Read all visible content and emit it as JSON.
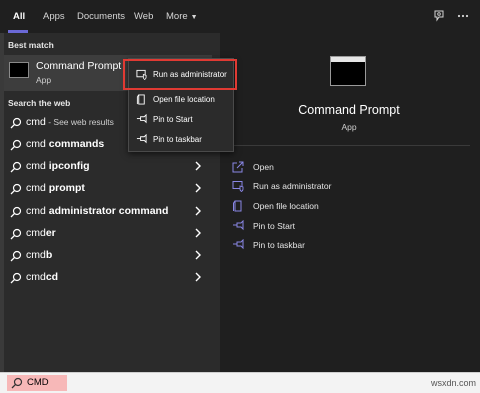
{
  "nav": {
    "tabs": [
      {
        "label": "All"
      },
      {
        "label": "Apps"
      },
      {
        "label": "Documents"
      },
      {
        "label": "Web"
      },
      {
        "label": "More"
      }
    ],
    "icons": [
      "feedback-icon",
      "more-options-icon"
    ]
  },
  "left": {
    "best_match_heading": "Best match",
    "best_match": {
      "title": "Command Prompt",
      "subtitle": "App",
      "icon": "terminal-icon"
    },
    "web_heading": "Search the web",
    "web_results": [
      {
        "query": "cmd",
        "suffix": " - See web results"
      },
      {
        "query": "cmd ",
        "bold": "commands"
      },
      {
        "query": "cmd ",
        "bold": "ipconfig"
      },
      {
        "query": "cmd ",
        "bold": "prompt"
      },
      {
        "query": "cmd ",
        "bold": "administrator command"
      },
      {
        "query": "cmd",
        "bold": "er"
      },
      {
        "query": "cmd",
        "bold": "b"
      },
      {
        "query": "cmd",
        "bold": "cd"
      }
    ]
  },
  "context_menu": {
    "items": [
      {
        "label": "Run as administrator",
        "icon": "shield-window-icon"
      },
      {
        "label": "Open file location",
        "icon": "folder-icon"
      },
      {
        "label": "Pin to Start",
        "icon": "pin-icon"
      },
      {
        "label": "Pin to taskbar",
        "icon": "pin-icon"
      }
    ],
    "highlight_color": "#e03a33"
  },
  "right": {
    "title": "Command Prompt",
    "subtitle": "App",
    "actions": [
      {
        "label": "Open",
        "icon": "open-icon"
      },
      {
        "label": "Run as administrator",
        "icon": "shield-window-icon"
      },
      {
        "label": "Open file location",
        "icon": "folder-icon"
      },
      {
        "label": "Pin to Start",
        "icon": "pin-icon"
      },
      {
        "label": "Pin to taskbar",
        "icon": "pin-icon"
      }
    ]
  },
  "search": {
    "value": "CMD",
    "highlight_color": "#f7b8b8"
  },
  "watermark": "wsxdn.com",
  "colors": {
    "accent": "#6b69d6",
    "icon_accent": "#8a87e6"
  }
}
